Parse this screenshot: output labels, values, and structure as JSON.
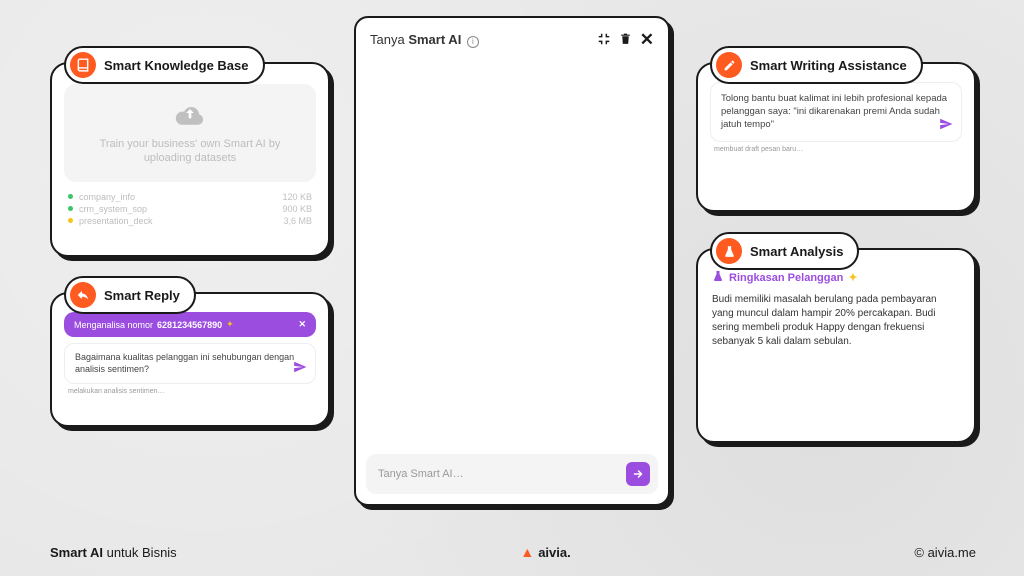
{
  "knowledge_base": {
    "title": "Smart Knowledge Base",
    "upload_text": "Train your business' own Smart AI by uploading datasets",
    "files": [
      {
        "name": "company_info",
        "size": "120 KB",
        "color": "#3ac569"
      },
      {
        "name": "crm_system_sop",
        "size": "900 KB",
        "color": "#3ac569"
      },
      {
        "name": "presentation_deck",
        "size": "3,6 MB",
        "color": "#f5c518"
      }
    ]
  },
  "smart_reply": {
    "title": "Smart Reply",
    "analyzing_prefix": "Menganalisa nomor",
    "phone": "6281234567890",
    "question": "Bagaimana kualitas pelanggan ini sehubungan dengan analisis sentimen?",
    "status": "melakukan analisis sentimen…"
  },
  "chat": {
    "title_prefix": "Tanya",
    "title_bold": "Smart AI",
    "placeholder": "Tanya Smart AI…"
  },
  "writing": {
    "title": "Smart Writing Assistance",
    "body": "Tolong bantu buat kalimat ini lebih profesional kepada pelanggan saya: \"ini dikarenakan premi Anda sudah jatuh tempo\"",
    "status": "membuat draft pesan baru…"
  },
  "analysis": {
    "title": "Smart Analysis",
    "section_title": "Ringkasan Pelanggan",
    "body": "Budi memiliki masalah berulang pada pembayaran yang muncul dalam hampir 20% percakapan. Budi sering membeli produk Happy dengan frekuensi sebanyak 5 kali dalam sebulan."
  },
  "footer": {
    "left_bold": "Smart AI",
    "left_rest": " untuk Bisnis",
    "brand": "aivia.",
    "right": "© aivia.me"
  }
}
